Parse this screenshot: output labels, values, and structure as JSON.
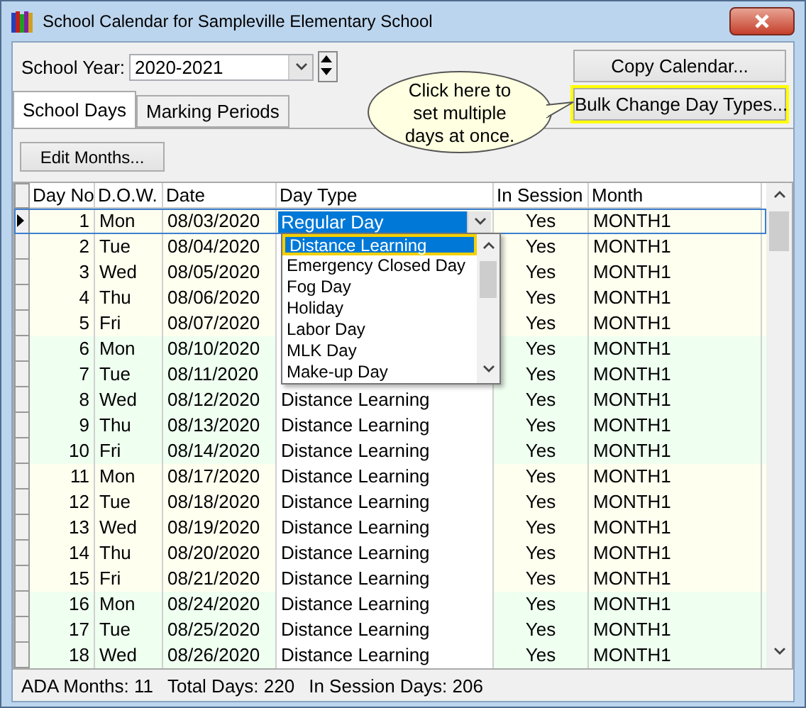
{
  "window": {
    "title": "School Calendar for Sampleville Elementary School"
  },
  "school_year": {
    "label": "School Year:",
    "value": "2020-2021"
  },
  "buttons": [
    {
      "label": "Copy Calendar...",
      "highlighted": false
    },
    {
      "label": "Bulk Change Day Types...",
      "highlighted": true
    }
  ],
  "callout": {
    "lines": [
      "Click here to",
      "set multiple",
      "days at once."
    ]
  },
  "tabs": [
    {
      "label": "School Days",
      "selected": true
    },
    {
      "label": "Marking Periods",
      "selected": false
    }
  ],
  "edit_months_button": "Edit Months...",
  "table": {
    "columns": [
      "Day No",
      "D.O.W.",
      "Date",
      "Day Type",
      "In Session",
      "Month"
    ],
    "rows": [
      {
        "day_no": "1",
        "dow": "Mon",
        "date": "08/03/2020",
        "day_type": "Regular Day",
        "in_session": "Yes",
        "month": "MONTH1",
        "color": "#fffff0",
        "selected": true,
        "editing": true
      },
      {
        "day_no": "2",
        "dow": "Tue",
        "date": "08/04/2020",
        "in_session": "Yes",
        "month": "MONTH1",
        "color": "#fffff0",
        "selected": false
      },
      {
        "day_no": "3",
        "dow": "Wed",
        "date": "08/05/2020",
        "in_session": "Yes",
        "month": "MONTH1",
        "color": "#fffff0",
        "selected": false
      },
      {
        "day_no": "4",
        "dow": "Thu",
        "date": "08/06/2020",
        "in_session": "Yes",
        "month": "MONTH1",
        "color": "#fffff0",
        "selected": false
      },
      {
        "day_no": "5",
        "dow": "Fri",
        "date": "08/07/2020",
        "in_session": "Yes",
        "month": "MONTH1",
        "color": "#fffff0",
        "selected": false
      },
      {
        "day_no": "6",
        "dow": "Mon",
        "date": "08/10/2020",
        "in_session": "Yes",
        "month": "MONTH1",
        "color": "#effff0",
        "selected": false
      },
      {
        "day_no": "7",
        "dow": "Tue",
        "date": "08/11/2020",
        "in_session": "Yes",
        "month": "MONTH1",
        "color": "#effff0",
        "selected": false
      },
      {
        "day_no": "8",
        "dow": "Wed",
        "date": "08/12/2020",
        "day_type": "Distance Learning",
        "in_session": "Yes",
        "month": "MONTH1",
        "color": "#effff0",
        "selected": false
      },
      {
        "day_no": "9",
        "dow": "Thu",
        "date": "08/13/2020",
        "day_type": "Distance Learning",
        "in_session": "Yes",
        "month": "MONTH1",
        "color": "#effff0",
        "selected": false
      },
      {
        "day_no": "10",
        "dow": "Fri",
        "date": "08/14/2020",
        "day_type": "Distance Learning",
        "in_session": "Yes",
        "month": "MONTH1",
        "color": "#effff0",
        "selected": false
      },
      {
        "day_no": "11",
        "dow": "Mon",
        "date": "08/17/2020",
        "day_type": "Distance Learning",
        "in_session": "Yes",
        "month": "MONTH1",
        "color": "#fffff0",
        "selected": false
      },
      {
        "day_no": "12",
        "dow": "Tue",
        "date": "08/18/2020",
        "day_type": "Distance Learning",
        "in_session": "Yes",
        "month": "MONTH1",
        "color": "#fffff0",
        "selected": false
      },
      {
        "day_no": "13",
        "dow": "Wed",
        "date": "08/19/2020",
        "day_type": "Distance Learning",
        "in_session": "Yes",
        "month": "MONTH1",
        "color": "#fffff0",
        "selected": false
      },
      {
        "day_no": "14",
        "dow": "Thu",
        "date": "08/20/2020",
        "day_type": "Distance Learning",
        "in_session": "Yes",
        "month": "MONTH1",
        "color": "#fffff0",
        "selected": false
      },
      {
        "day_no": "15",
        "dow": "Fri",
        "date": "08/21/2020",
        "day_type": "Distance Learning",
        "in_session": "Yes",
        "month": "MONTH1",
        "color": "#fffff0",
        "selected": false
      },
      {
        "day_no": "16",
        "dow": "Mon",
        "date": "08/24/2020",
        "day_type": "Distance Learning",
        "in_session": "Yes",
        "month": "MONTH1",
        "color": "#effff0",
        "selected": false
      },
      {
        "day_no": "17",
        "dow": "Tue",
        "date": "08/25/2020",
        "day_type": "Distance Learning",
        "in_session": "Yes",
        "month": "MONTH1",
        "color": "#effff0",
        "selected": false
      },
      {
        "day_no": "18",
        "dow": "Wed",
        "date": "08/26/2020",
        "day_type": "Distance Learning",
        "in_session": "Yes",
        "month": "MONTH1",
        "color": "#effff0",
        "selected": false
      }
    ]
  },
  "dropdown": {
    "items": [
      {
        "label": "Distance Learning",
        "selected": true
      },
      {
        "label": "Emergency Closed Day",
        "selected": false
      },
      {
        "label": "Fog Day",
        "selected": false
      },
      {
        "label": "Holiday",
        "selected": false
      },
      {
        "label": "Labor Day",
        "selected": false
      },
      {
        "label": "MLK Day",
        "selected": false
      },
      {
        "label": "Make-up Day",
        "selected": false
      }
    ]
  },
  "status_bar": [
    "ADA Months: 11",
    "Total Days: 220",
    "In Session Days: 206"
  ]
}
